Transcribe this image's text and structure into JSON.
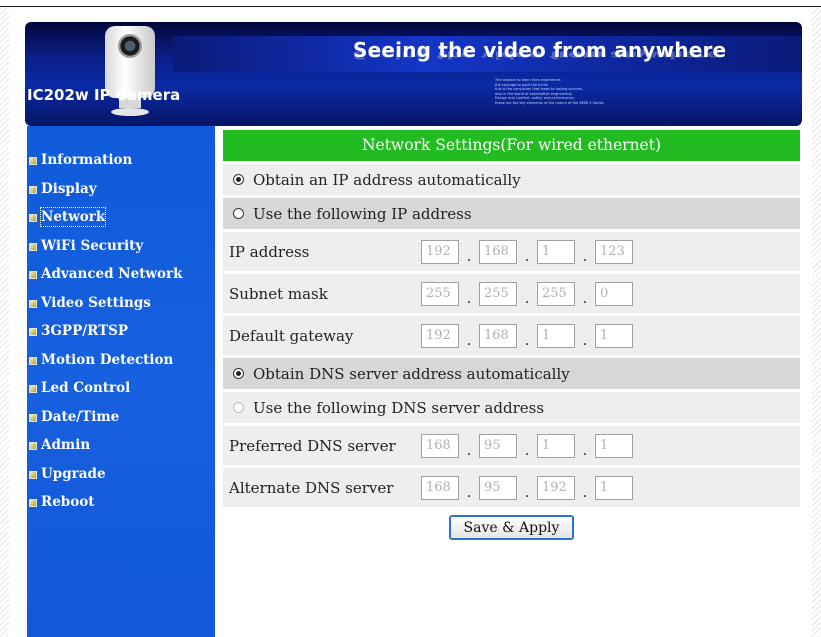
{
  "banner": {
    "title": "Seeing the video from anywhere",
    "model": "IC202w IP Camera",
    "tagline": [
      "The wisdom to learn from experience,",
      "the courage to push the limits",
      "this is the conviction that leads to lasting success,",
      "also in the world of automotive engineering.",
      "Design and comfort, safety and performance -",
      "these are the key elements of the nature of the BMW 5 Series."
    ]
  },
  "sidebar": {
    "items": [
      {
        "label": "Information"
      },
      {
        "label": "Display"
      },
      {
        "label": "Network"
      },
      {
        "label": "WiFi Security"
      },
      {
        "label": "Advanced Network"
      },
      {
        "label": "Video Settings"
      },
      {
        "label": "3GPP/RTSP"
      },
      {
        "label": "Motion Detection"
      },
      {
        "label": "Led Control"
      },
      {
        "label": "Date/Time"
      },
      {
        "label": "Admin"
      },
      {
        "label": "Upgrade"
      },
      {
        "label": "Reboot"
      }
    ],
    "active_item": "Network"
  },
  "network": {
    "header": "Network Settings(For wired ethernet)",
    "ip_mode": {
      "auto_label": "Obtain an IP address automatically",
      "manual_label": "Use the following IP address",
      "selected": "auto"
    },
    "ip_address": {
      "label": "IP address",
      "octets": [
        "192",
        "168",
        "1",
        "123"
      ]
    },
    "subnet_mask": {
      "label": "Subnet mask",
      "octets": [
        "255",
        "255",
        "255",
        "0"
      ]
    },
    "gateway": {
      "label": "Default gateway",
      "octets": [
        "192",
        "168",
        "1",
        "1"
      ]
    },
    "dns_mode": {
      "auto_label": "Obtain DNS server address automatically",
      "manual_label": "Use the following DNS server address",
      "selected": "auto"
    },
    "preferred_dns": {
      "label": "Preferred DNS server",
      "octets": [
        "168",
        "95",
        "1",
        "1"
      ]
    },
    "alternate_dns": {
      "label": "Alternate DNS server",
      "octets": [
        "168",
        "95",
        "192",
        "1"
      ]
    },
    "octet_separator": ".",
    "save_label": "Save & Apply"
  },
  "colors": {
    "sidebar": "#1760df",
    "header_bar": "#22bb22",
    "row_light": "#eeeeee",
    "row_dark": "#d7d7d7"
  }
}
